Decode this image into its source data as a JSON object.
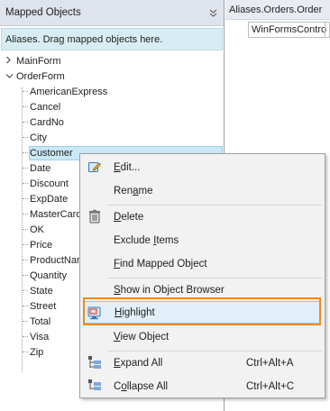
{
  "left_panel": {
    "title": "Mapped Objects",
    "info_text": "Aliases. Drag mapped objects here.",
    "tree": {
      "roots": [
        {
          "label": "MainForm",
          "expanded": false
        },
        {
          "label": "OrderForm",
          "expanded": true
        }
      ],
      "children": [
        "AmericanExpress",
        "Cancel",
        "CardNo",
        "City",
        "Customer",
        "Date",
        "Discount",
        "ExpDate",
        "MasterCard",
        "OK",
        "Price",
        "ProductNam",
        "Quantity",
        "State",
        "Street",
        "Total",
        "Visa",
        "Zip"
      ],
      "selected": "Customer"
    }
  },
  "right_panel": {
    "header": "Aliases.Orders.Order",
    "row_text": "WinFormsContro"
  },
  "context_menu": {
    "items": [
      {
        "label": "Edit...",
        "icon": "edit-icon"
      },
      {
        "label": "Rename"
      },
      {
        "label": "Delete",
        "icon": "trash-icon"
      },
      {
        "label": "Exclude Items"
      },
      {
        "label": "Find Mapped Object"
      },
      {
        "label": "Show in Object Browser"
      },
      {
        "label": "Highlight",
        "icon": "highlight-icon",
        "highlighted": true
      },
      {
        "label": "View Object"
      },
      {
        "label": "Expand All",
        "shortcut": "Ctrl+Alt+A",
        "icon": "expand-all-icon"
      },
      {
        "label": "Collapse All",
        "shortcut": "Ctrl+Alt+C",
        "icon": "collapse-all-icon"
      }
    ]
  },
  "colors": {
    "highlight_frame": "#f08a1c",
    "selection_bg": "#cbe8f6",
    "info_bar_bg": "#d8edf3"
  }
}
